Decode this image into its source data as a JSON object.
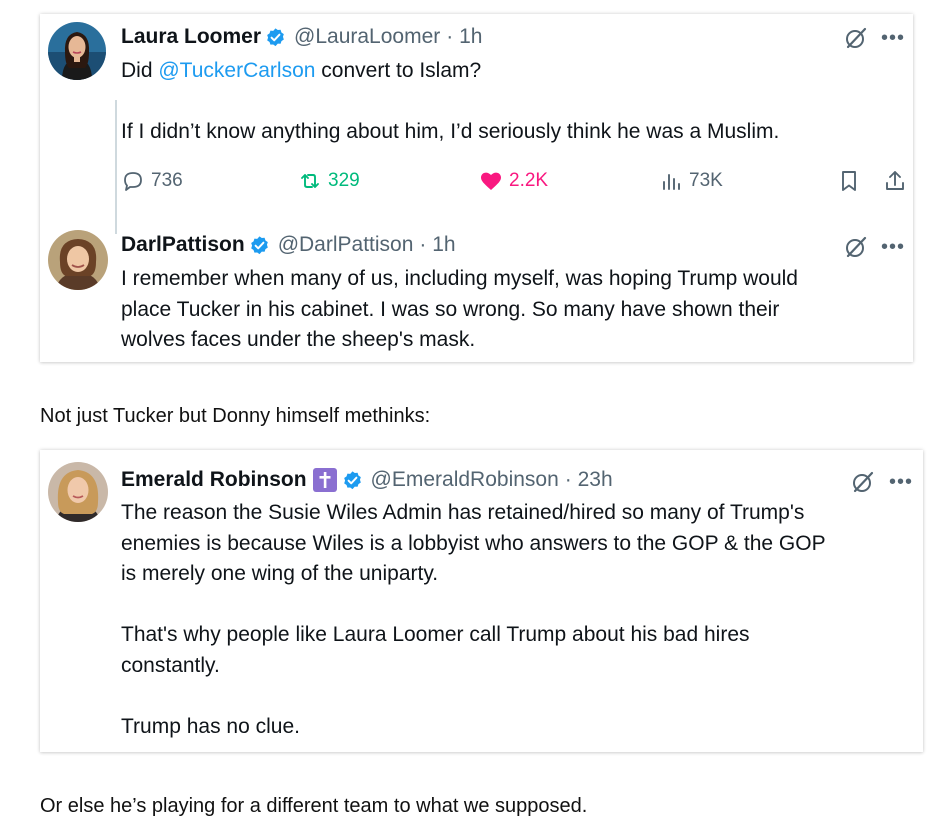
{
  "tweet1": {
    "author_name": "Laura Loomer",
    "author_handle": "@LauraLoomer",
    "time": "· 1h",
    "text_prefix": "Did ",
    "mention": "@TuckerCarlson",
    "text_suffix": " convert to Islam?",
    "text_line2": "If I didn’t know anything about him, I’d seriously think he was a Muslim.",
    "replies": "736",
    "reposts": "329",
    "likes": "2.2K",
    "views": "73K"
  },
  "tweet2": {
    "author_name": "DarlPattison",
    "author_handle": "@DarlPattison",
    "time": "· 1h",
    "text": "I remember when many of us, including myself, was hoping Trump would\nplace Tucker in his cabinet. I was so wrong. So many have shown their\nwolves faces under the sheep's mask."
  },
  "comment1": "Not just Tucker but Donny himself methinks:",
  "tweet3": {
    "author_name": "Emerald Robinson",
    "author_handle": "@EmeraldRobinson",
    "time": "· 23h",
    "text": "The reason the Susie Wiles Admin has retained/hired so many of Trump's\nenemies is because Wiles is a lobbyist who answers to the GOP & the GOP\nis merely one wing of the uniparty.\n\nThat's why people like Laura Loomer call Trump about his bad hires\nconstantly.\n\nTrump has no clue."
  },
  "comment2": "Or else he’s playing for a different team to what we supposed.",
  "colors": {
    "verified": "#1d9bf0",
    "repost": "#00ba7c",
    "like": "#f91880",
    "text_secondary": "#536471"
  }
}
